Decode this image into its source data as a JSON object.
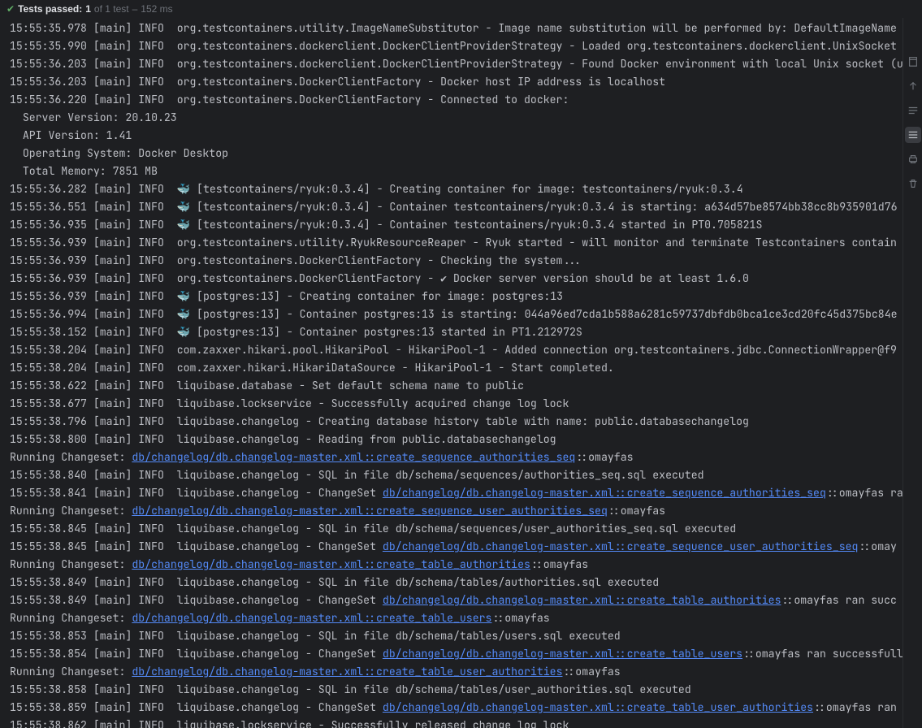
{
  "status": {
    "label": "Tests passed:",
    "count": "1",
    "of": "of 1 test",
    "dash": "–",
    "time": "152 ms"
  },
  "lines": [
    {
      "t": "plain",
      "s": "15:55:35.978 [main] INFO  org.testcontainers.utility.ImageNameSubstitutor - Image name substitution will be performed by: DefaultImageName"
    },
    {
      "t": "plain",
      "s": "15:55:35.990 [main] INFO  org.testcontainers.dockerclient.DockerClientProviderStrategy - Loaded org.testcontainers.dockerclient.UnixSocket"
    },
    {
      "t": "plain",
      "s": "15:55:36.203 [main] INFO  org.testcontainers.dockerclient.DockerClientProviderStrategy - Found Docker environment with local Unix socket (u"
    },
    {
      "t": "plain",
      "s": "15:55:36.203 [main] INFO  org.testcontainers.DockerClientFactory - Docker host IP address is localhost"
    },
    {
      "t": "plain",
      "s": "15:55:36.220 [main] INFO  org.testcontainers.DockerClientFactory - Connected to docker: "
    },
    {
      "t": "plain",
      "s": "  Server Version: 20.10.23"
    },
    {
      "t": "plain",
      "s": "  API Version: 1.41"
    },
    {
      "t": "plain",
      "s": "  Operating System: Docker Desktop"
    },
    {
      "t": "plain",
      "s": "  Total Memory: 7851 MB"
    },
    {
      "t": "plain",
      "s": "15:55:36.282 [main] INFO  🐳 [testcontainers/ryuk:0.3.4] - Creating container for image: testcontainers/ryuk:0.3.4"
    },
    {
      "t": "plain",
      "s": "15:55:36.551 [main] INFO  🐳 [testcontainers/ryuk:0.3.4] - Container testcontainers/ryuk:0.3.4 is starting: a634d57be8574bb38cc8b935901d76"
    },
    {
      "t": "plain",
      "s": "15:55:36.935 [main] INFO  🐳 [testcontainers/ryuk:0.3.4] - Container testcontainers/ryuk:0.3.4 started in PT0.705821S"
    },
    {
      "t": "plain",
      "s": "15:55:36.939 [main] INFO  org.testcontainers.utility.RyukResourceReaper - Ryuk started - will monitor and terminate Testcontainers contain"
    },
    {
      "t": "plain",
      "s": "15:55:36.939 [main] INFO  org.testcontainers.DockerClientFactory - Checking the system..."
    },
    {
      "t": "plain",
      "s": "15:55:36.939 [main] INFO  org.testcontainers.DockerClientFactory - ✔ Docker server version should be at least 1.6.0"
    },
    {
      "t": "plain",
      "s": "15:55:36.939 [main] INFO  🐳 [postgres:13] - Creating container for image: postgres:13"
    },
    {
      "t": "plain",
      "s": "15:55:36.994 [main] INFO  🐳 [postgres:13] - Container postgres:13 is starting: 044a96ed7cda1b588a6281c59737dbfdb0bca1ce3cd20fc45d375bc84e"
    },
    {
      "t": "plain",
      "s": "15:55:38.152 [main] INFO  🐳 [postgres:13] - Container postgres:13 started in PT1.212972S"
    },
    {
      "t": "plain",
      "s": "15:55:38.204 [main] INFO  com.zaxxer.hikari.pool.HikariPool - HikariPool-1 - Added connection org.testcontainers.jdbc.ConnectionWrapper@f9"
    },
    {
      "t": "plain",
      "s": "15:55:38.204 [main] INFO  com.zaxxer.hikari.HikariDataSource - HikariPool-1 - Start completed."
    },
    {
      "t": "plain",
      "s": "15:55:38.622 [main] INFO  liquibase.database - Set default schema name to public"
    },
    {
      "t": "plain",
      "s": "15:55:38.677 [main] INFO  liquibase.lockservice - Successfully acquired change log lock"
    },
    {
      "t": "plain",
      "s": "15:55:38.796 [main] INFO  liquibase.changelog - Creating database history table with name: public.databasechangelog"
    },
    {
      "t": "plain",
      "s": "15:55:38.800 [main] INFO  liquibase.changelog - Reading from public.databasechangelog"
    },
    {
      "t": "link",
      "pre": "Running Changeset: ",
      "link": "db/changelog/db.changelog-master.xml::create_sequence_authorities_seq",
      "post": "::omayfas"
    },
    {
      "t": "plain",
      "s": "15:55:38.840 [main] INFO  liquibase.changelog - SQL in file db/schema/sequences/authorities_seq.sql executed"
    },
    {
      "t": "link",
      "pre": "15:55:38.841 [main] INFO  liquibase.changelog - ChangeSet ",
      "link": "db/changelog/db.changelog-master.xml::create_sequence_authorities_seq",
      "post": "::omayfas ra"
    },
    {
      "t": "link",
      "pre": "Running Changeset: ",
      "link": "db/changelog/db.changelog-master.xml::create_sequence_user_authorities_seq",
      "post": "::omayfas"
    },
    {
      "t": "plain",
      "s": "15:55:38.845 [main] INFO  liquibase.changelog - SQL in file db/schema/sequences/user_authorities_seq.sql executed"
    },
    {
      "t": "link",
      "pre": "15:55:38.845 [main] INFO  liquibase.changelog - ChangeSet ",
      "link": "db/changelog/db.changelog-master.xml::create_sequence_user_authorities_seq",
      "post": "::omay"
    },
    {
      "t": "link",
      "pre": "Running Changeset: ",
      "link": "db/changelog/db.changelog-master.xml::create_table_authorities",
      "post": "::omayfas"
    },
    {
      "t": "plain",
      "s": "15:55:38.849 [main] INFO  liquibase.changelog - SQL in file db/schema/tables/authorities.sql executed"
    },
    {
      "t": "link",
      "pre": "15:55:38.849 [main] INFO  liquibase.changelog - ChangeSet ",
      "link": "db/changelog/db.changelog-master.xml::create_table_authorities",
      "post": "::omayfas ran succ"
    },
    {
      "t": "link",
      "pre": "Running Changeset: ",
      "link": "db/changelog/db.changelog-master.xml::create_table_users",
      "post": "::omayfas"
    },
    {
      "t": "plain",
      "s": "15:55:38.853 [main] INFO  liquibase.changelog - SQL in file db/schema/tables/users.sql executed"
    },
    {
      "t": "link",
      "pre": "15:55:38.854 [main] INFO  liquibase.changelog - ChangeSet ",
      "link": "db/changelog/db.changelog-master.xml::create_table_users",
      "post": "::omayfas ran successfull"
    },
    {
      "t": "link",
      "pre": "Running Changeset: ",
      "link": "db/changelog/db.changelog-master.xml::create_table_user_authorities",
      "post": "::omayfas"
    },
    {
      "t": "plain",
      "s": "15:55:38.858 [main] INFO  liquibase.changelog - SQL in file db/schema/tables/user_authorities.sql executed"
    },
    {
      "t": "link",
      "pre": "15:55:38.859 [main] INFO  liquibase.changelog - ChangeSet ",
      "link": "db/changelog/db.changelog-master.xml::create_table_user_authorities",
      "post": "::omayfas ran"
    },
    {
      "t": "plain",
      "s": "15:55:38.862 [main] INFO  liquibase.lockservice - Successfully released change log lock"
    }
  ]
}
